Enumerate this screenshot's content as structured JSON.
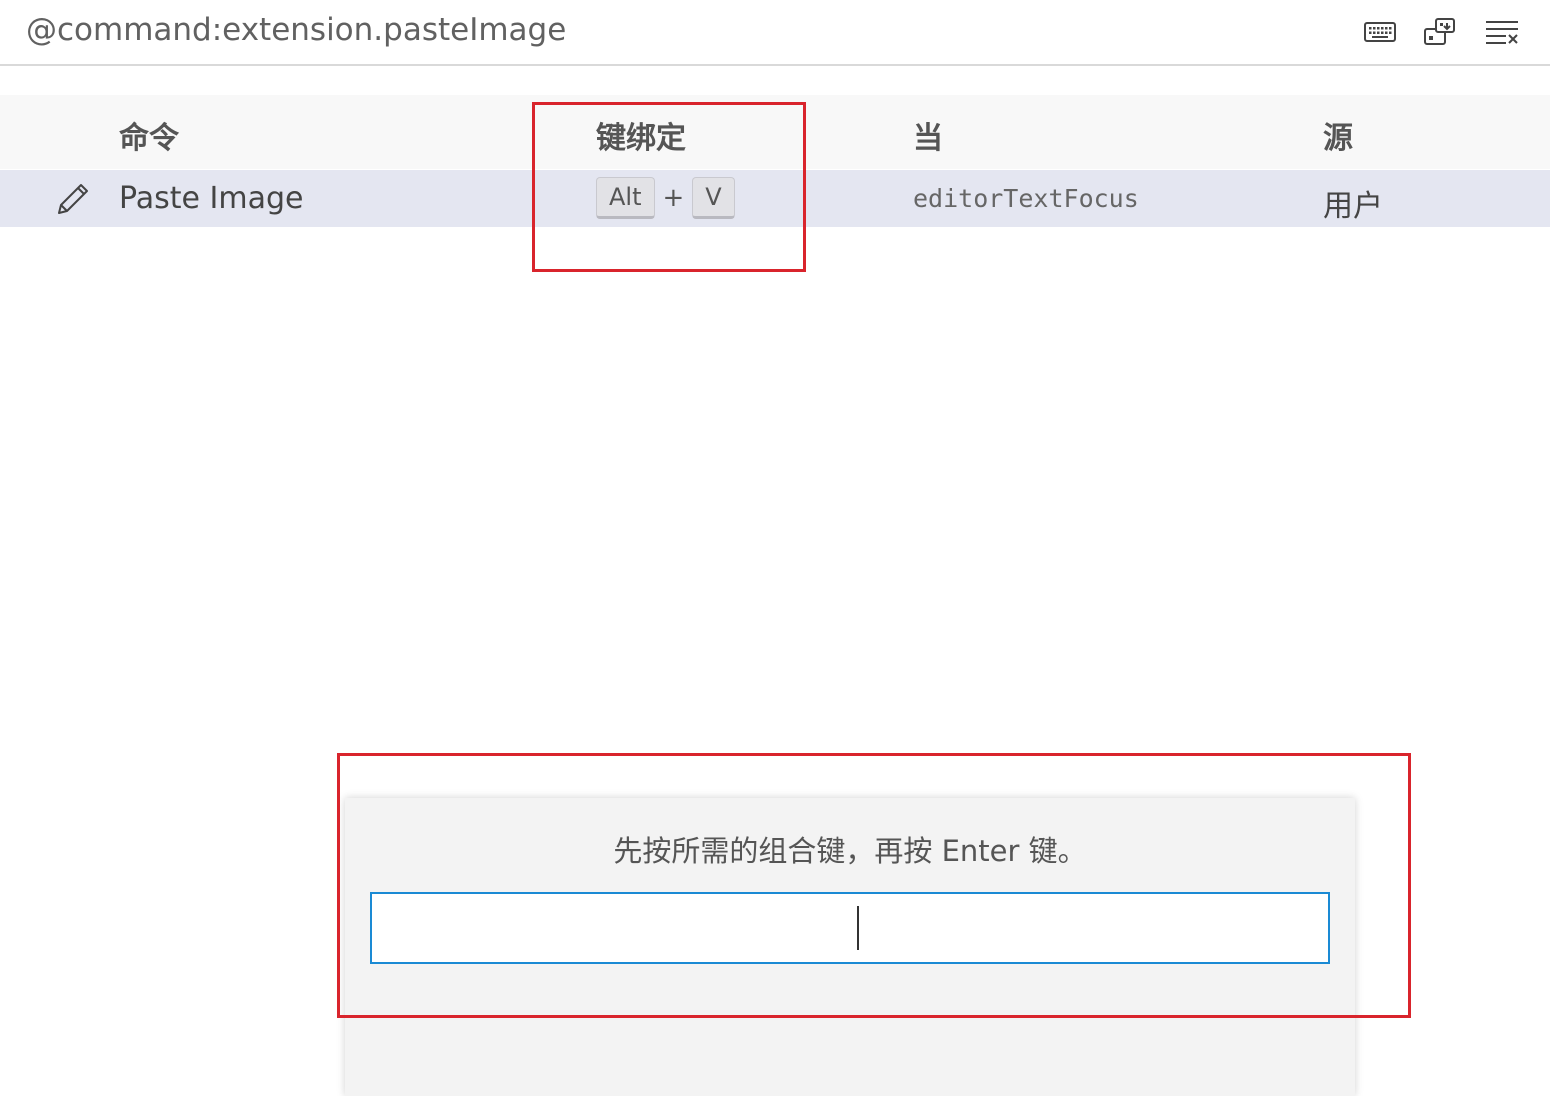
{
  "search": {
    "query": "@command:extension.pasteImage"
  },
  "toolbar": {
    "icons": [
      "keyboard-icon",
      "record-keys-icon",
      "clear-search-icon"
    ]
  },
  "table": {
    "headers": {
      "command": "命令",
      "keybinding": "键绑定",
      "when": "当",
      "source": "源"
    },
    "rows": [
      {
        "command": "Paste Image",
        "keys": [
          "Alt",
          "V"
        ],
        "separator": "+",
        "when": "editorTextFocus",
        "source": "用户",
        "icon": "pencil-icon"
      }
    ]
  },
  "dialog": {
    "message": "先按所需的组合键，再按 Enter 键。",
    "input_value": ""
  },
  "colors": {
    "highlight_box": "#d9242c",
    "row_selected": "#e4e6f1",
    "input_focus_border": "#1a8ad4"
  }
}
